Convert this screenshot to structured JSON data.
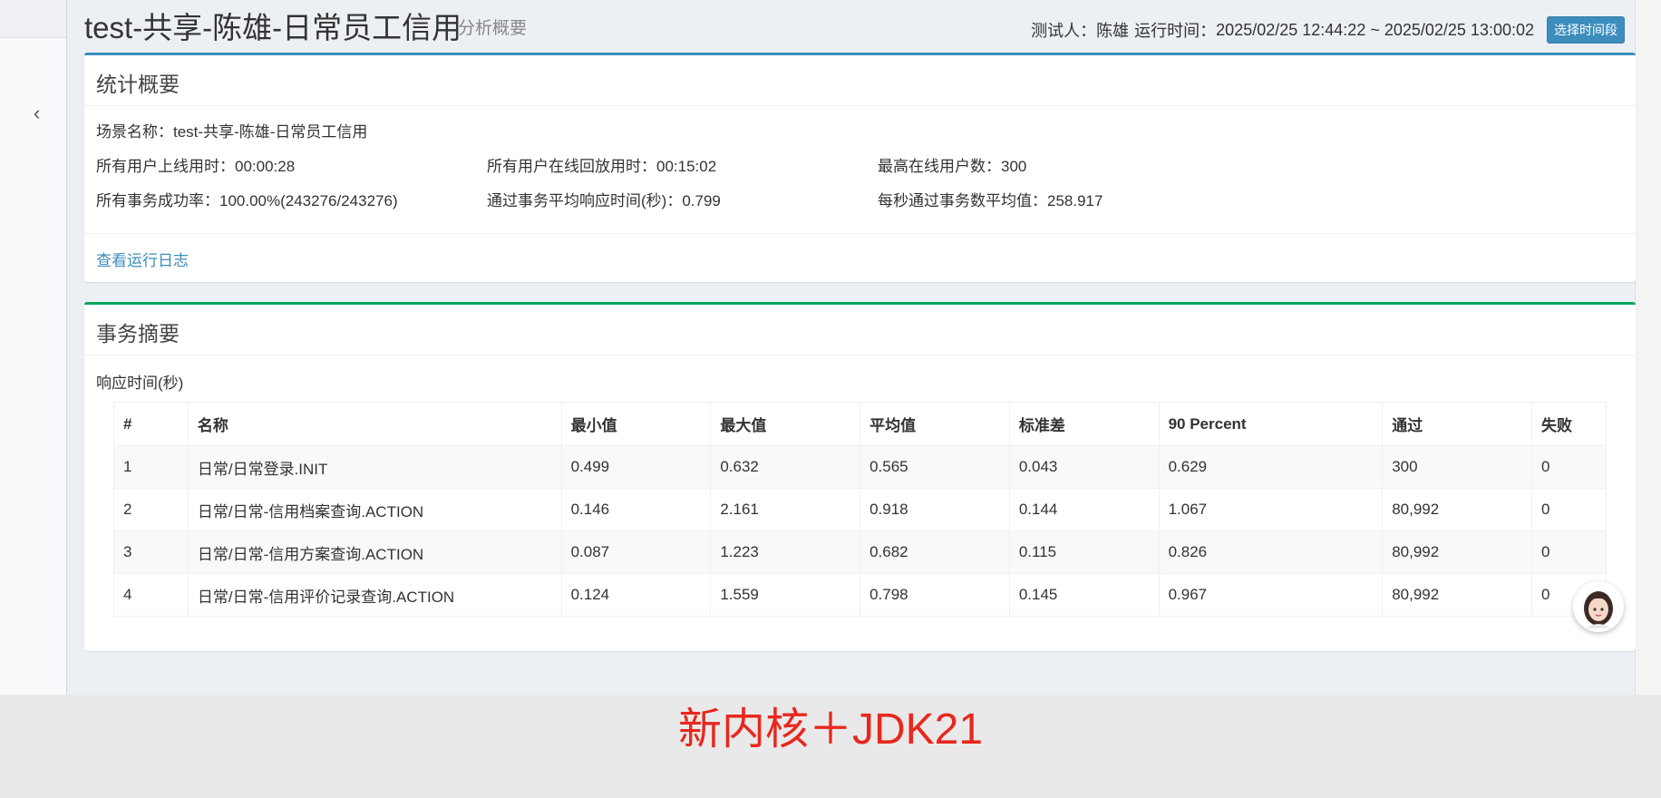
{
  "header": {
    "title": "test-共享-陈雄-日常员工信用",
    "subtitle": "分析概要",
    "tester_label": "测试人：",
    "tester": "陈雄",
    "runtime_label": "运行时间：",
    "runtime": "2025/02/25 12:44:22 ~ 2025/02/25 13:00:02",
    "period_button": "选择时间段"
  },
  "sidebar": {
    "collapse_icon": "‹"
  },
  "stats": {
    "title": "统计概要",
    "scene": "场景名称：test-共享-陈雄-日常员工信用",
    "rows": [
      [
        "所有用户上线用时：00:00:28",
        "所有用户在线回放用时：00:15:02",
        "最高在线用户数：300"
      ],
      [
        "所有事务成功率：100.00%(243276/243276)",
        "通过事务平均响应时间(秒)：0.799",
        "每秒通过事务数平均值：258.917"
      ]
    ],
    "log_link": "查看运行日志"
  },
  "transactions": {
    "title": "事务摘要",
    "subtitle": "响应时间(秒)",
    "columns": [
      "#",
      "名称",
      "最小值",
      "最大值",
      "平均值",
      "标准差",
      "90 Percent",
      "通过",
      "失败"
    ],
    "rows": [
      [
        "1",
        "日常/日常登录.INIT",
        "0.499",
        "0.632",
        "0.565",
        "0.043",
        "0.629",
        "300",
        "0"
      ],
      [
        "2",
        "日常/日常-信用档案查询.ACTION",
        "0.146",
        "2.161",
        "0.918",
        "0.144",
        "1.067",
        "80,992",
        "0"
      ],
      [
        "3",
        "日常/日常-信用方案查询.ACTION",
        "0.087",
        "1.223",
        "0.682",
        "0.115",
        "0.826",
        "80,992",
        "0"
      ],
      [
        "4",
        "日常/日常-信用评价记录查询.ACTION",
        "0.124",
        "1.559",
        "0.798",
        "0.145",
        "0.967",
        "80,992",
        "0"
      ]
    ]
  },
  "caption": "新内核＋JDK21",
  "colors": {
    "accent_blue": "#3c8dbc",
    "accent_green": "#00a65a",
    "caption_red": "#e8271d"
  }
}
